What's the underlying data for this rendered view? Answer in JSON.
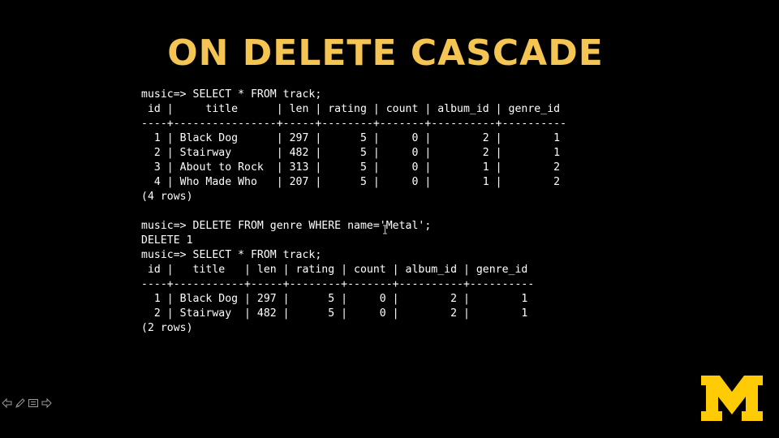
{
  "slide": {
    "title": "ON DELETE CASCADE"
  },
  "colors": {
    "background": "#000000",
    "title": "#F5C554",
    "text": "#FFFFFF",
    "logo": "#FFCB05"
  },
  "terminal": {
    "lines": [
      "music=> SELECT * FROM track;",
      " id |     title      | len | rating | count | album_id | genre_id",
      "----+----------------+-----+--------+-------+----------+----------",
      "  1 | Black Dog      | 297 |      5 |     0 |        2 |        1",
      "  2 | Stairway       | 482 |      5 |     0 |        2 |        1",
      "  3 | About to Rock  | 313 |      5 |     0 |        1 |        2",
      "  4 | Who Made Who   | 207 |      5 |     0 |        1 |        2",
      "(4 rows)",
      "",
      "music=> DELETE FROM genre WHERE name='Metal';",
      "DELETE 1",
      "music=> SELECT * FROM track;",
      " id |   title   | len | rating | count | album_id | genre_id",
      "----+-----------+-----+--------+-------+----------+----------",
      "  1 | Black Dog | 297 |      5 |     0 |        2 |        1",
      "  2 | Stairway  | 482 |      5 |     0 |        2 |        1",
      "(2 rows)"
    ]
  },
  "icons": {
    "nav": [
      "arrow-left-icon",
      "pen-icon",
      "menu-icon",
      "arrow-right-icon"
    ],
    "logo": "block-m-logo",
    "cursor": "text-cursor-icon"
  }
}
